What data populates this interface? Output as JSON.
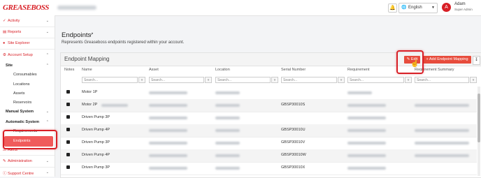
{
  "header": {
    "logo_text": "GREASEBOSS",
    "language": "English",
    "user_name": "Adam",
    "user_role": "Super Admin",
    "avatar_initial": "A"
  },
  "sidebar": {
    "activity": "Activity",
    "reports": "Reports",
    "site_explorer": "Site Explorer",
    "account_setup": "Account Setup",
    "site": "Site",
    "consumables": "Consumables",
    "locations": "Locations",
    "assets": "Assets",
    "reservoirs": "Reservoirs",
    "manual_system": "Manual System",
    "automatic_system": "Automatic System",
    "requirements": "Requirements",
    "endpoints": "Endpoints",
    "alerts": "Alerts",
    "administration": "Administration",
    "support_centre": "Support Centre"
  },
  "page": {
    "title": "Endpoints",
    "subtitle": "Represents Greaseboss endpoints registered within your account."
  },
  "card": {
    "title": "Endpoint Mapping",
    "edit_label": "Edit",
    "add_label": "+ Add Endpoint Mapping"
  },
  "table": {
    "columns": [
      "Notes",
      "Name",
      "Asset",
      "Location",
      "Serial Number",
      "Requirement",
      "Requirement Summary"
    ],
    "search_placeholder": "Search...",
    "rows": [
      {
        "name": "Motor 1P",
        "serial": ""
      },
      {
        "name": "Motor 2P",
        "serial": "GBSP30010S"
      },
      {
        "name": "Driven Pump 3P",
        "serial": ""
      },
      {
        "name": "Driven Pump 4P",
        "serial": "GBSP30010U"
      },
      {
        "name": "Driven Pump 3P",
        "serial": "GBSP30010V"
      },
      {
        "name": "Driven Pump 4P",
        "serial": "GBSP30010W"
      },
      {
        "name": "Driven Pump 3P",
        "serial": "GBSP30010X"
      }
    ]
  },
  "colors": {
    "brand_red": "#d81f26",
    "button_red": "#e74c3c"
  }
}
